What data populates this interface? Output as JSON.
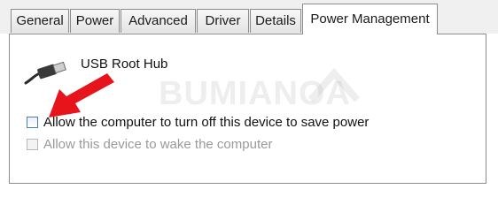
{
  "tabs": [
    {
      "label": "General"
    },
    {
      "label": "Power"
    },
    {
      "label": "Advanced"
    },
    {
      "label": "Driver"
    },
    {
      "label": "Details"
    },
    {
      "label": "Power Management",
      "active": true
    }
  ],
  "device": {
    "name": "USB Root Hub",
    "icon": "usb-plug-icon"
  },
  "watermark": "BUMIANOA",
  "options": [
    {
      "label": "Allow the computer to turn off this device to save power",
      "checked": false,
      "enabled": true
    },
    {
      "label": "Allow this device to wake the computer",
      "checked": false,
      "enabled": false
    }
  ],
  "annotation": {
    "icon": "red-arrow-icon",
    "color": "#e8141b"
  },
  "colors": {
    "tab_border": "#8c8c8c",
    "checkbox_border": "#4a7fb5",
    "disabled_text": "#9a9a9a"
  }
}
